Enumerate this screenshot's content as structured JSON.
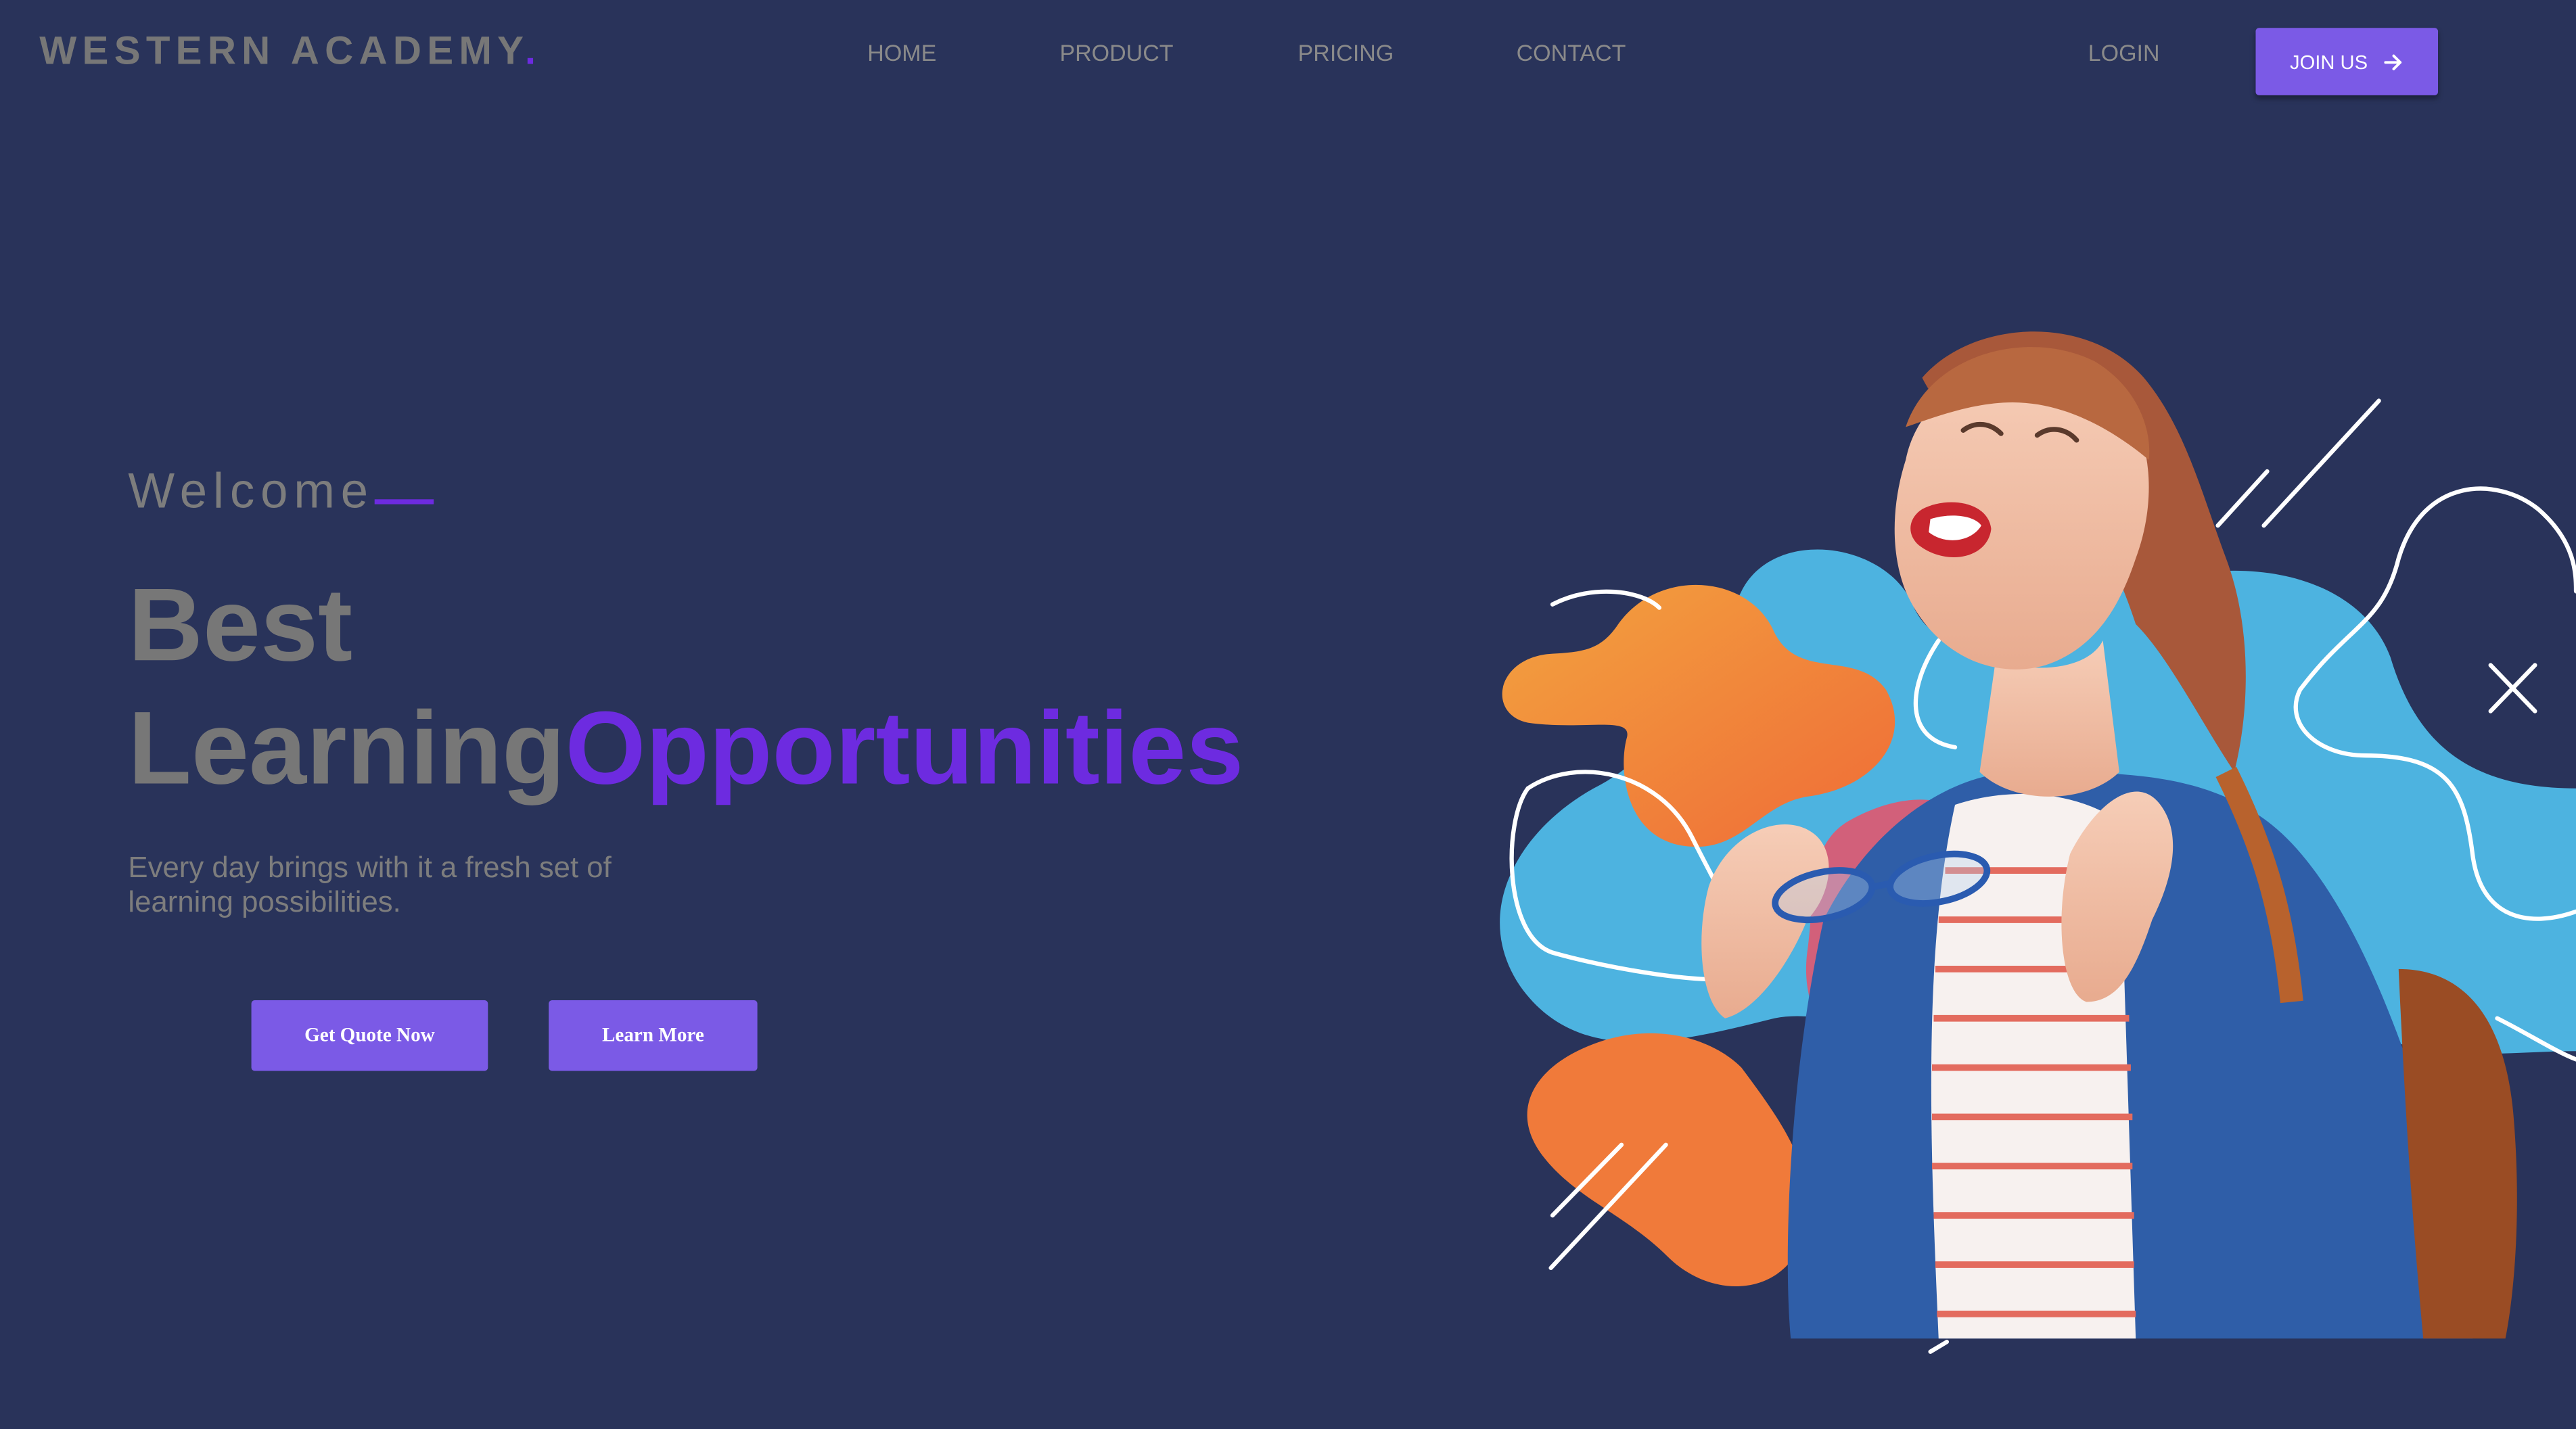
{
  "brand": {
    "name": "WESTERN ACADEMY",
    "dot": ".",
    "accent_color": "#6d2be0"
  },
  "nav": {
    "items": [
      {
        "label": "HOME"
      },
      {
        "label": "PRODUCT"
      },
      {
        "label": "PRICING"
      },
      {
        "label": "CONTACT"
      }
    ],
    "login_label": "LOGIN",
    "join_label": "JOIN US",
    "join_icon": "arrow-right-icon"
  },
  "hero": {
    "welcome": "Welcome",
    "headline_line1": "Best",
    "headline_line2_plain": "Learning",
    "headline_line2_accent": "Opportunities",
    "subtext": "Every day brings with it a fresh set of learning possibilities.",
    "primary_cta": "Get Quote Now",
    "secondary_cta": "Learn More",
    "image_label": "student-illustration"
  },
  "colors": {
    "background": "#29335a",
    "button": "#7b5ae6",
    "text_gray": "#777777",
    "blob_blue": "#4db3e0",
    "blob_orange": "#f07a3a"
  }
}
